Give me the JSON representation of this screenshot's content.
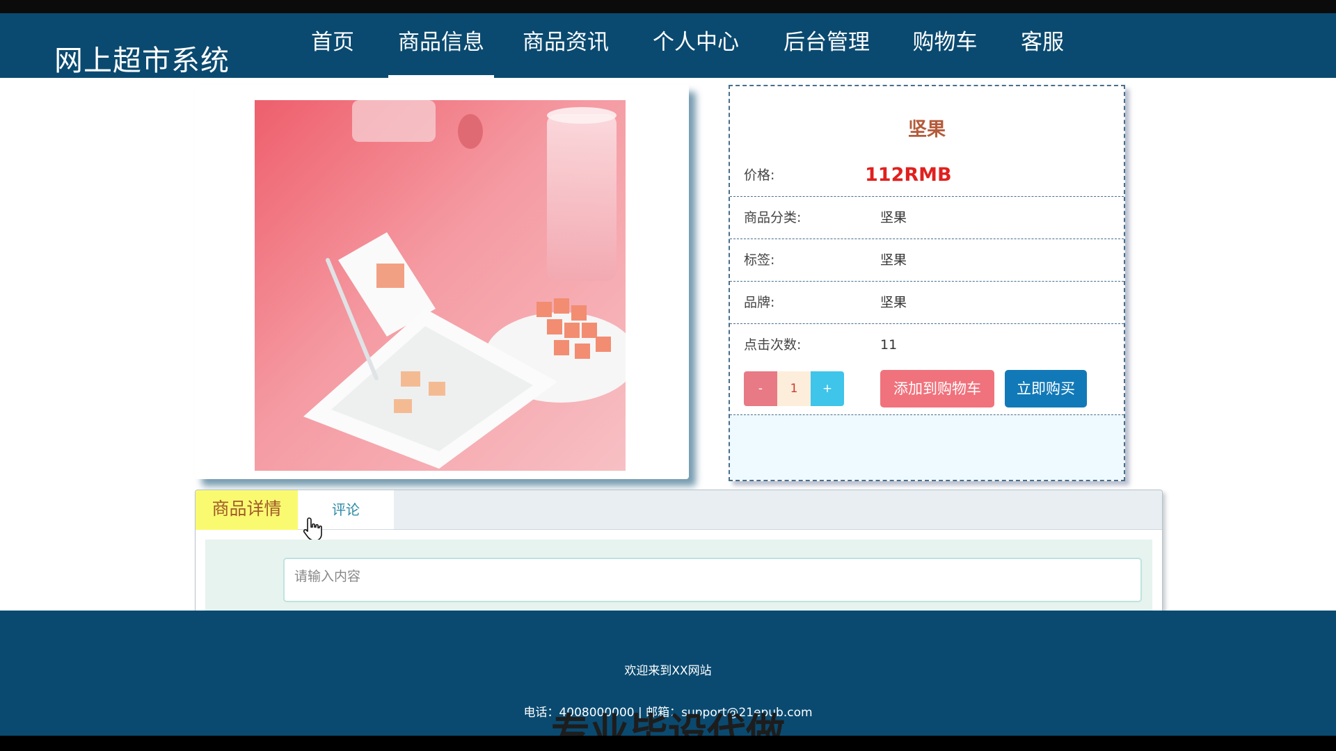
{
  "brand": {
    "title": "网上超市系统"
  },
  "nav": {
    "items": [
      {
        "label": "首页"
      },
      {
        "label": "商品信息",
        "active": true
      },
      {
        "label": "商品资讯"
      },
      {
        "label": "个人中心"
      },
      {
        "label": "后台管理"
      },
      {
        "label": "购物车"
      },
      {
        "label": "客服"
      }
    ]
  },
  "product": {
    "name": "坚果",
    "price_label": "价格:",
    "price": "112RMB",
    "rows": [
      {
        "label": "商品分类:",
        "value": "坚果"
      },
      {
        "label": "标签:",
        "value": "坚果"
      },
      {
        "label": "品牌:",
        "value": "坚果"
      },
      {
        "label": "点击次数:",
        "value": "11"
      }
    ]
  },
  "purchase": {
    "minus": "-",
    "quantity": "1",
    "plus": "+",
    "add_to_cart": "添加到购物车",
    "buy_now": "立即购买"
  },
  "tabs": {
    "detail": "商品详情",
    "comment": "评论"
  },
  "comment_box": {
    "placeholder": "请输入内容"
  },
  "footer": {
    "welcome": "欢迎来到XX网站",
    "contact": "电话：4008000000 | 邮箱：support@21epub.com"
  },
  "watermark": {
    "text": "专业毕设代做"
  },
  "colors": {
    "nav_bg": "#0a4a70",
    "price": "#e0201e",
    "add_to_cart_bg": "#f0727c",
    "buy_now_bg": "#1279b8",
    "active_tab_bg": "#fafa70"
  }
}
